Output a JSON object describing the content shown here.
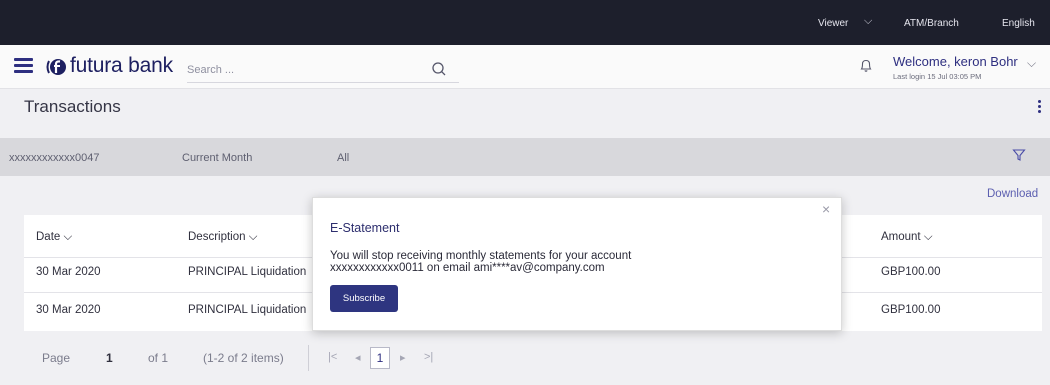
{
  "topbar": {
    "viewer": "Viewer",
    "atm_branch": "ATM/Branch",
    "language": "English"
  },
  "header": {
    "brand": "futura bank",
    "search_placeholder": "Search ...",
    "welcome": "Welcome, keron Bohr",
    "last_login": "Last login 15 Jul 03:05 PM"
  },
  "page": {
    "title": "Transactions"
  },
  "filters": {
    "account": "xxxxxxxxxxxx0047",
    "period": "Current Month",
    "type": "All"
  },
  "download_label": "Download",
  "table": {
    "columns": [
      "Date",
      "Description",
      "Amount"
    ],
    "rows": [
      {
        "date": "30 Mar 2020",
        "description": "PRINCIPAL Liquidation",
        "amount": "GBP100.00"
      },
      {
        "date": "30 Mar 2020",
        "description": "PRINCIPAL Liquidation",
        "amount": "GBP100.00"
      }
    ]
  },
  "pagination": {
    "page_label": "Page",
    "current_page": "1",
    "of_label": "of 1",
    "items_info": "(1-2 of 2 items)",
    "page_box": "1"
  },
  "modal": {
    "title": "E-Statement",
    "line1": "You will stop receiving monthly statements for your account",
    "line2": "xxxxxxxxxxxx0011 on email ami****av@company.com",
    "subscribe_label": "Subscribe",
    "close_glyph": "×"
  },
  "colors": {
    "topbar_bg": "#1d1f2c",
    "brand": "#2e2f80",
    "button": "#2e3580"
  }
}
